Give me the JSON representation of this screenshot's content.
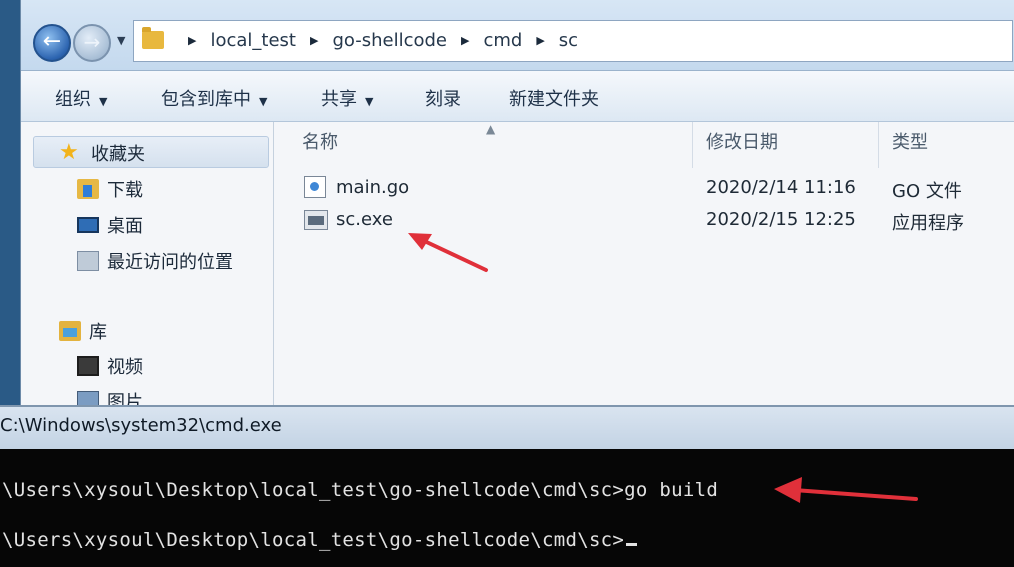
{
  "explorer": {
    "breadcrumbs": [
      "local_test",
      "go-shellcode",
      "cmd",
      "sc"
    ],
    "toolbar": {
      "organize": "组织",
      "include_in_library": "包含到库中",
      "share": "共享",
      "burn": "刻录",
      "new_folder": "新建文件夹"
    },
    "nav": {
      "favorites": "收藏夹",
      "downloads": "下载",
      "desktop": "桌面",
      "recent_places": "最近访问的位置",
      "libraries": "库",
      "videos": "视频",
      "pictures": "图片"
    },
    "columns": {
      "name": "名称",
      "date_modified": "修改日期",
      "type": "类型"
    },
    "files": [
      {
        "name": "main.go",
        "date": "2020/2/14 11:16",
        "type": "GO 文件",
        "icon": "go-file-icon"
      },
      {
        "name": "sc.exe",
        "date": "2020/2/15 12:25",
        "type": "应用程序",
        "icon": "exe-file-icon"
      }
    ]
  },
  "cmd": {
    "title": "C:\\Windows\\system32\\cmd.exe",
    "lines": [
      "\\Users\\xysoul\\Desktop\\local_test\\go-shellcode\\cmd\\sc>go build",
      "\\Users\\xysoul\\Desktop\\local_test\\go-shellcode\\cmd\\sc>"
    ]
  },
  "colors": {
    "annotation_arrow": "#e0303a",
    "cmd_background": "#060606",
    "cmd_text": "#e2e2e2"
  }
}
